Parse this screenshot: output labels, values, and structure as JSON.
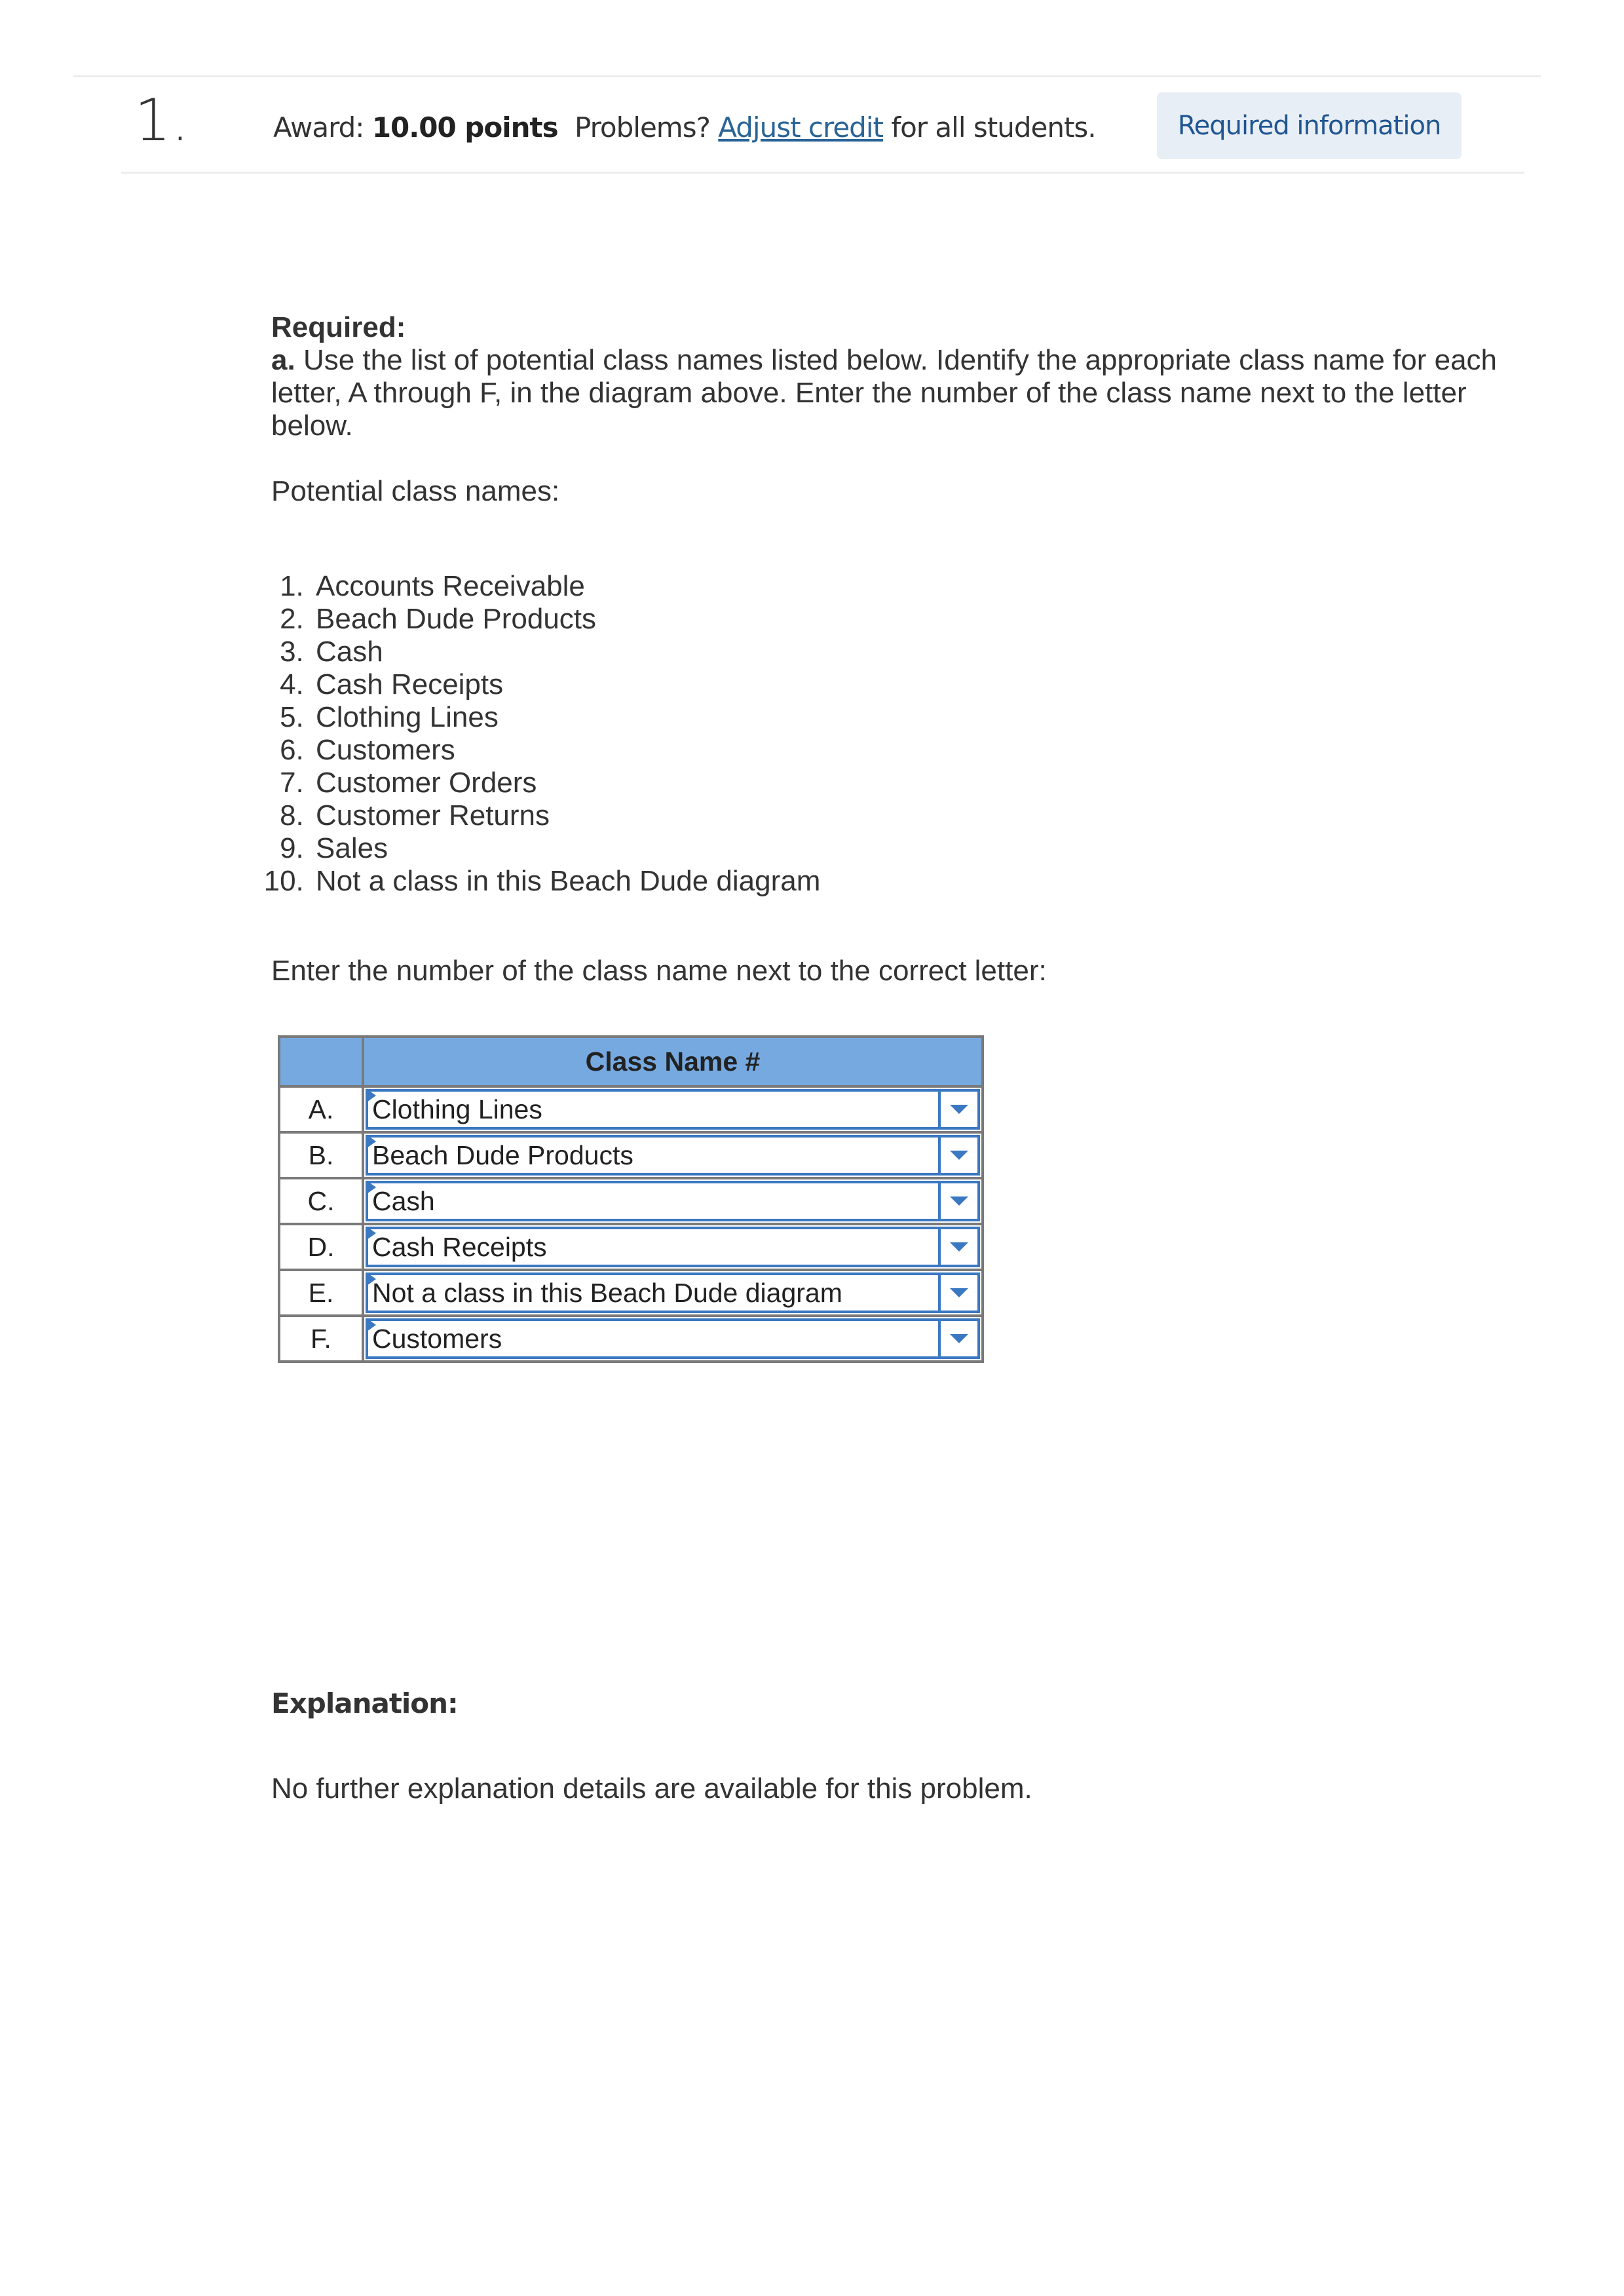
{
  "header": {
    "question_number": "1.",
    "award_label": "Award:",
    "award_value": "10.00 points",
    "problems_prefix": "Problems?",
    "adjust_credit_link": "Adjust credit",
    "problems_suffix": "for all students.",
    "required_info_button": "Required information"
  },
  "content": {
    "required_title": "Required:",
    "part_label": "a.",
    "instruction": "Use the list of potential class names listed below. Identify the appropriate class name for each letter, A through F, in the diagram above. Enter the number of the class name next to the letter below.",
    "potential_label": "Potential class names:",
    "class_names": [
      "Accounts Receivable",
      "Beach Dude Products",
      "Cash",
      "Cash Receipts",
      "Clothing Lines",
      "Customers",
      "Customer Orders",
      "Customer Returns",
      "Sales",
      "Not a class in this Beach Dude diagram"
    ],
    "enter_prompt": "Enter the number of the class name next to the correct letter:"
  },
  "table": {
    "header_blank": "",
    "header_col": "Class Name #",
    "rows": [
      {
        "letter": "A.",
        "value": "Clothing Lines"
      },
      {
        "letter": "B.",
        "value": "Beach Dude Products"
      },
      {
        "letter": "C.",
        "value": "Cash"
      },
      {
        "letter": "D.",
        "value": "Cash Receipts"
      },
      {
        "letter": "E.",
        "value": "Not a class in this Beach Dude diagram"
      },
      {
        "letter": "F.",
        "value": "Customers"
      }
    ]
  },
  "explanation": {
    "title": "Explanation:",
    "text": "No further explanation details are available for this problem."
  },
  "colors": {
    "accent": "#3b78c2",
    "table_header": "#76a9e0",
    "link": "#2a6496",
    "button_bg": "#e8eef5",
    "button_text": "#1f5591"
  }
}
